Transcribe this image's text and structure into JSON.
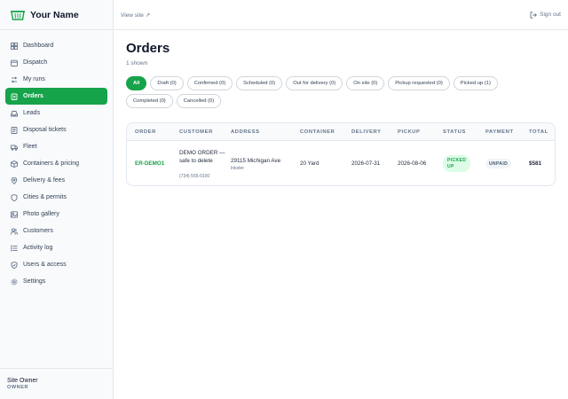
{
  "brand": {
    "name": "Your Name",
    "icon": "dumpster-icon"
  },
  "sidebar": {
    "items": [
      {
        "label": "Dashboard",
        "icon": "grid-icon"
      },
      {
        "label": "Dispatch",
        "icon": "calendar-icon"
      },
      {
        "label": "My runs",
        "icon": "route-icon"
      },
      {
        "label": "Orders",
        "icon": "clipboard-icon",
        "active": true
      },
      {
        "label": "Leads",
        "icon": "inbox-icon"
      },
      {
        "label": "Disposal tickets",
        "icon": "ticket-icon"
      },
      {
        "label": "Fleet",
        "icon": "truck-icon"
      },
      {
        "label": "Containers & pricing",
        "icon": "box-icon"
      },
      {
        "label": "Delivery & fees",
        "icon": "pin-icon"
      },
      {
        "label": "Cities & permits",
        "icon": "shield-icon"
      },
      {
        "label": "Photo gallery",
        "icon": "image-icon"
      },
      {
        "label": "Customers",
        "icon": "users-icon"
      },
      {
        "label": "Activity log",
        "icon": "list-icon"
      },
      {
        "label": "Users & access",
        "icon": "shield-check-icon"
      },
      {
        "label": "Settings",
        "icon": "gear-icon"
      }
    ],
    "user": {
      "name": "Site Owner",
      "role": "OWNER"
    }
  },
  "topbar": {
    "view_site": "View site ↗",
    "sign_out": "Sign out"
  },
  "main": {
    "title": "Orders",
    "count": "1 shown",
    "filters": [
      {
        "label": "All",
        "active": true
      },
      {
        "label": "Draft (0)"
      },
      {
        "label": "Confirmed (0)"
      },
      {
        "label": "Scheduled (0)"
      },
      {
        "label": "Out for delivery (0)"
      },
      {
        "label": "On site (0)"
      },
      {
        "label": "Pickup requested (0)"
      },
      {
        "label": "Picked up (1)"
      },
      {
        "label": "Completed (0)"
      },
      {
        "label": "Cancelled (0)"
      }
    ],
    "table": {
      "columns": [
        "ORDER",
        "CUSTOMER",
        "ADDRESS",
        "CONTAINER",
        "DELIVERY",
        "PICKUP",
        "STATUS",
        "PAYMENT",
        "TOTAL"
      ],
      "rows": [
        {
          "order": "ER-DEMO1",
          "customer": "DEMO ORDER — safe to delete",
          "phone": "(734) 555-0100",
          "address": "29115 Michigan Ave",
          "city": "Inkster",
          "container": "20 Yard",
          "delivery": "2026-07-31",
          "pickup": "2026-08-06",
          "status": "PICKED UP",
          "payment": "UNPAID",
          "total": "$581"
        }
      ]
    }
  },
  "colors": {
    "accent": "#16a34a",
    "status_bg": "#dcfce7",
    "border": "#e5e7eb"
  }
}
